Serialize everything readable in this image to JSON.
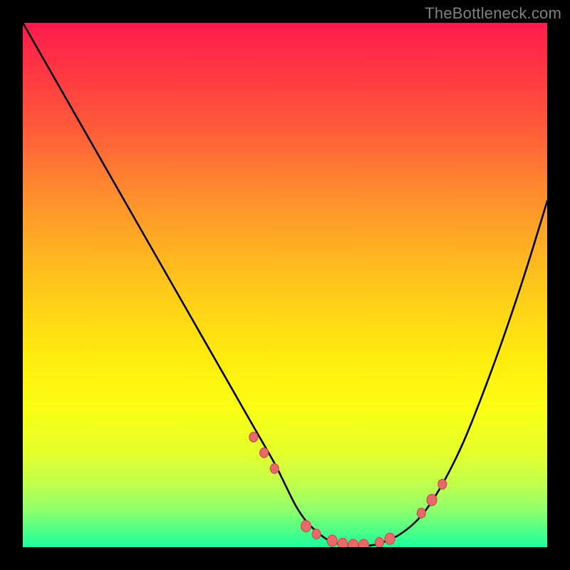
{
  "watermark": "TheBottleneck.com",
  "colors": {
    "dot_fill": "#e76a6a",
    "dot_stroke": "#c94f4f",
    "curve": "#000000"
  },
  "chart_data": {
    "type": "line",
    "title": "",
    "xlabel": "",
    "ylabel": "",
    "x_range": [
      0,
      100
    ],
    "y_range": [
      0,
      100
    ],
    "series": [
      {
        "name": "curve",
        "x": [
          0,
          4,
          8,
          12,
          16,
          20,
          24,
          28,
          32,
          36,
          40,
          44,
          48,
          50,
          52,
          54,
          56,
          58,
          60,
          62,
          64,
          66,
          68,
          72,
          76,
          80,
          84,
          88,
          92,
          96,
          100
        ],
        "y": [
          100,
          93,
          86,
          79,
          72,
          65,
          58,
          51,
          44,
          37,
          30,
          23,
          16,
          12,
          8,
          5,
          3,
          1.5,
          0.7,
          0.3,
          0.2,
          0.3,
          0.7,
          2.5,
          6,
          12,
          20,
          30,
          41,
          53,
          66
        ]
      }
    ],
    "dots": {
      "x": [
        44,
        46,
        48,
        54,
        56,
        59,
        61,
        63,
        65,
        68,
        70,
        76,
        78,
        80
      ],
      "y": [
        21,
        18,
        15,
        4,
        2.5,
        1.2,
        0.6,
        0.4,
        0.4,
        0.9,
        1.6,
        6.5,
        9,
        12
      ],
      "r": [
        6,
        6,
        6,
        7,
        6,
        7,
        7,
        7,
        7,
        6,
        7,
        6,
        7,
        6
      ]
    }
  }
}
